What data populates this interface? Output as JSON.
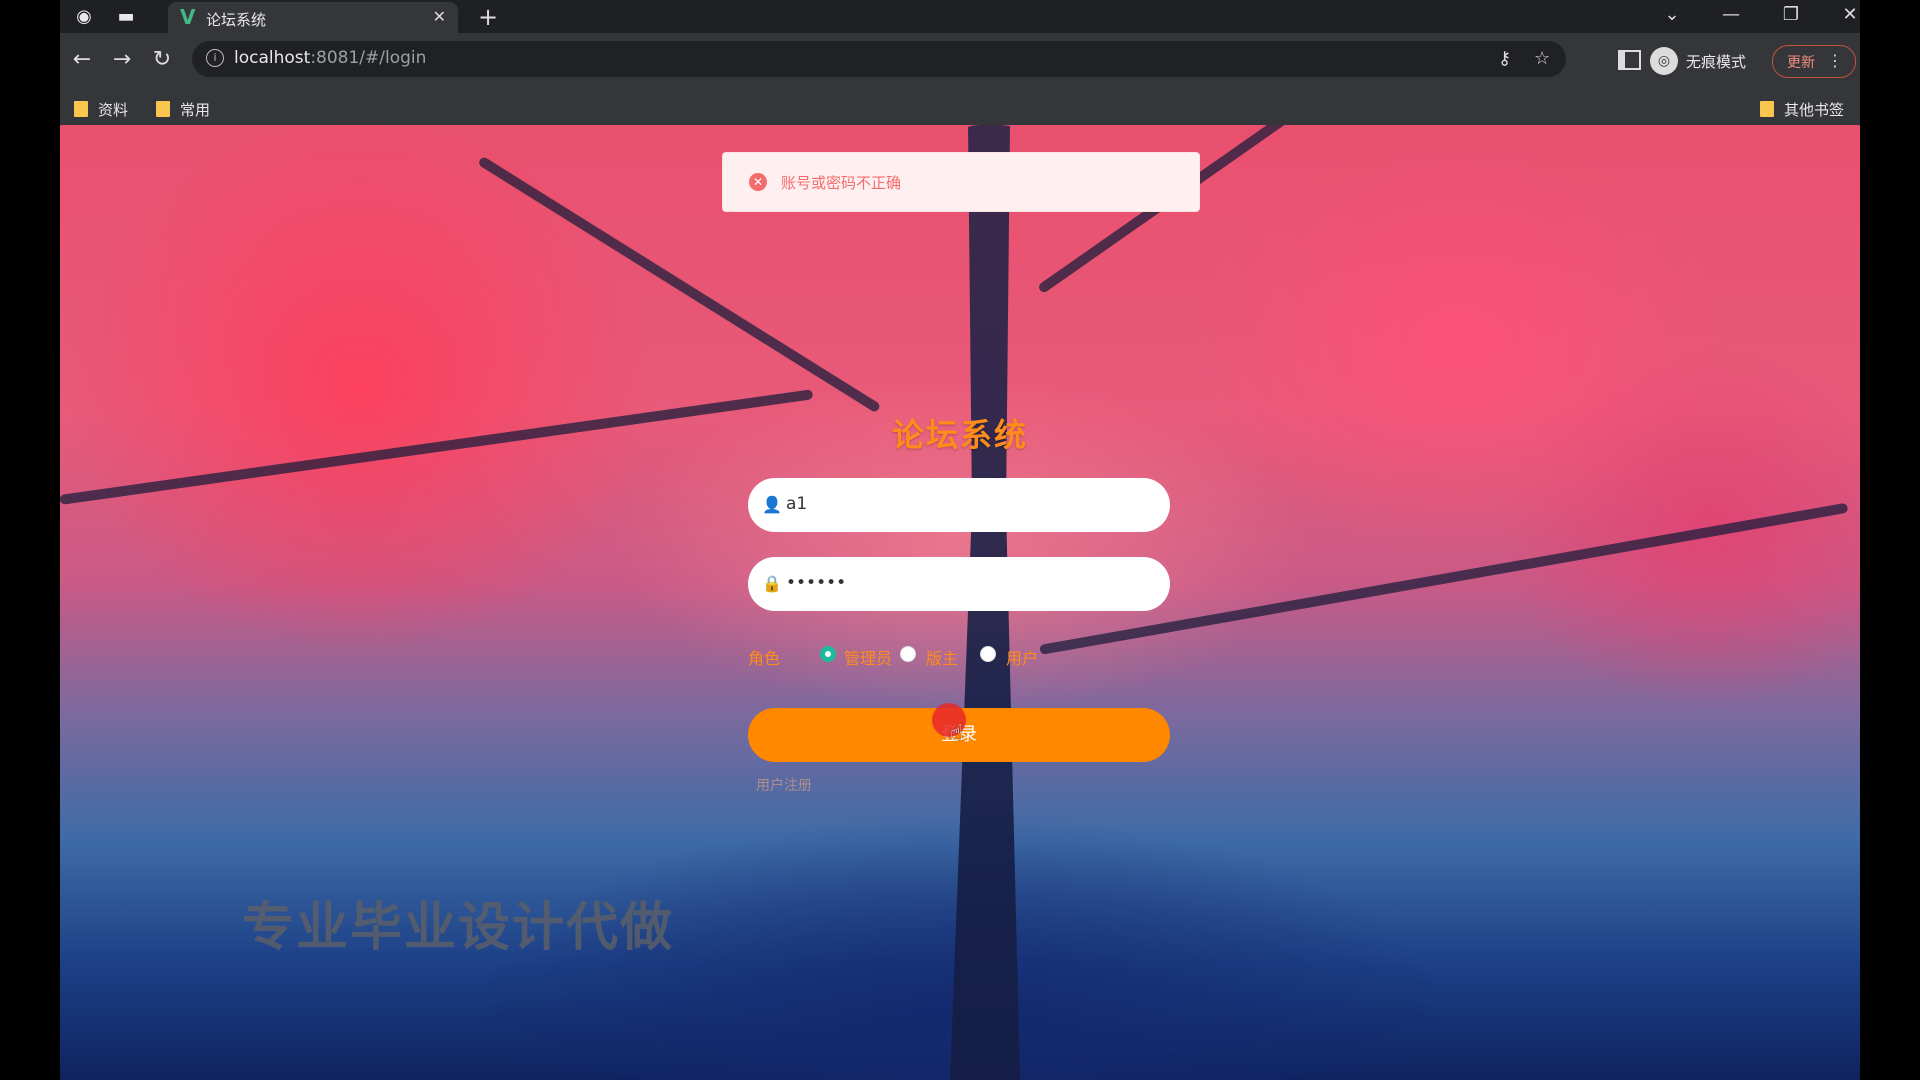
{
  "browser": {
    "tab_title": "论坛系统",
    "tab_favicon": "V",
    "url_host": "localhost",
    "url_rest": ":8081/#/login",
    "incognito_label": "无痕模式",
    "update_label": "更新",
    "bookmarks": [
      {
        "label": "资料"
      },
      {
        "label": "常用"
      }
    ],
    "other_bookmarks": "其他书签"
  },
  "message": {
    "text": "账号或密码不正确",
    "color": "#f56c6c"
  },
  "login": {
    "title": "论坛系统",
    "username_value": "a1",
    "password_value": "••••••",
    "role_label": "角色",
    "roles": [
      {
        "label": "管理员",
        "selected": true
      },
      {
        "label": "版主",
        "selected": false
      },
      {
        "label": "用户",
        "selected": false
      }
    ],
    "login_button": "登录",
    "register_link": "用户注册",
    "accent_color": "#ff8800"
  },
  "watermark": "专业毕业设计代做"
}
